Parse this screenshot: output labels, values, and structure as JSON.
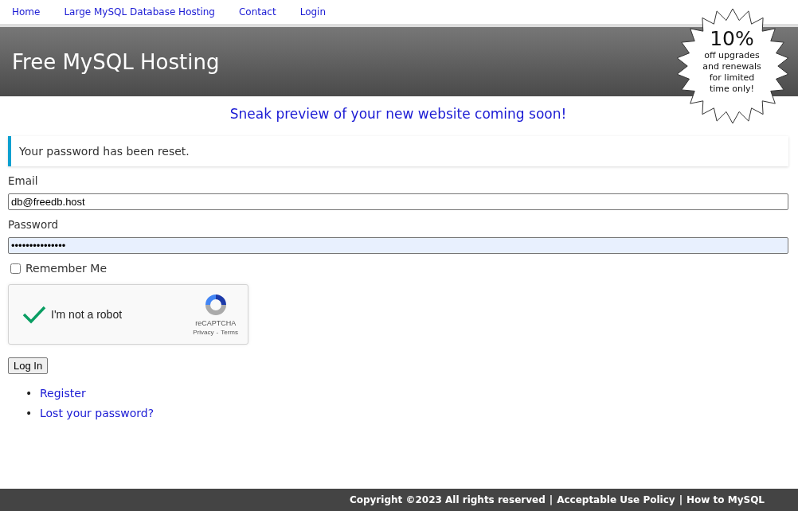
{
  "nav": {
    "links": [
      {
        "label": "Home"
      },
      {
        "label": "Large MySQL Database Hosting"
      },
      {
        "label": "Contact"
      },
      {
        "label": "Login"
      }
    ]
  },
  "header": {
    "title": "Free MySQL Hosting"
  },
  "promo": {
    "headline": "10%",
    "lines": [
      "off upgrades",
      "and renewals",
      "for limited",
      "time only!"
    ]
  },
  "tagline": "Sneak preview of your new website coming soon!",
  "notice": "Your password has been reset.",
  "form": {
    "email_label": "Email",
    "email_value": "db@freedb.host",
    "password_label": "Password",
    "password_value": "•••••••••••••••",
    "password_autofilled": true,
    "remember": {
      "label": "Remember Me",
      "checked": false
    },
    "captcha": {
      "label": "I'm not a robot",
      "checked": true,
      "brand": "reCAPTCHA",
      "privacy": "Privacy",
      "dash": "-",
      "terms": "Terms"
    },
    "submit": "Log In",
    "links": [
      {
        "bullet": "•",
        "label": "Register"
      },
      {
        "bullet": "•",
        "label": "Lost your password?"
      }
    ]
  },
  "footer": {
    "items": [
      "Copyright ©2023 All rights reserved",
      "Acceptable Use Policy",
      "How to MySQL"
    ],
    "separator": "|"
  }
}
